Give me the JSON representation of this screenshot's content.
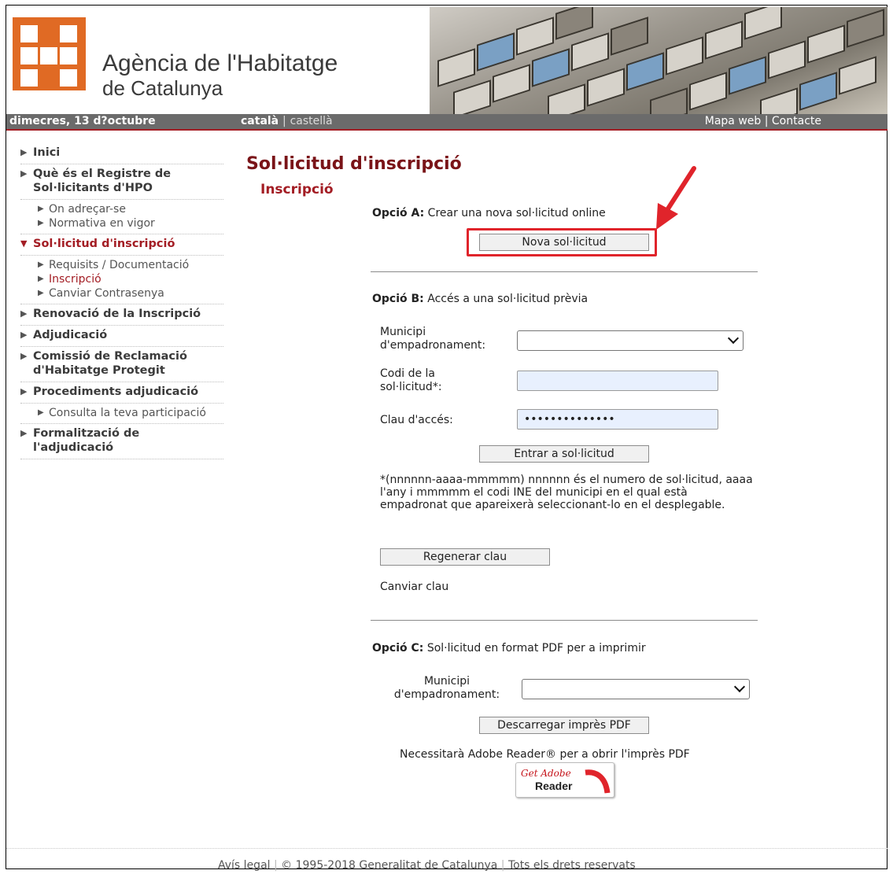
{
  "header": {
    "brand_line1": "Agència de l'Habitatge",
    "brand_line2": "de Catalunya"
  },
  "navbar": {
    "date": "dimecres, 13 d?octubre",
    "lang_current": "català",
    "lang_separator": "|",
    "lang_alt": "castellà",
    "links": "Mapa web | Contacte"
  },
  "sidebar": {
    "items": [
      {
        "label": "Inici"
      },
      {
        "label": "Què és el Registre de Sol·licitants d'HPO"
      },
      {
        "label": "On adreçar-se"
      },
      {
        "label": "Normativa en vigor"
      },
      {
        "label": "Sol·licitud d'inscripció"
      },
      {
        "label": "Requisits / Documentació"
      },
      {
        "label": "Inscripció"
      },
      {
        "label": "Canviar Contrasenya"
      },
      {
        "label": "Renovació de la Inscripció"
      },
      {
        "label": "Adjudicació"
      },
      {
        "label": "Comissió de Reclamació d'Habitatge Protegit"
      },
      {
        "label": "Procediments adjudicació"
      },
      {
        "label": "Consulta la teva participació"
      },
      {
        "label": "Formalització de l'adjudicació"
      }
    ]
  },
  "main": {
    "title": "Sol·licitud d'inscripció",
    "subtitle": "Inscripció",
    "optionA": {
      "heading": "Opció A:",
      "text": "Crear una nova sol·licitud online",
      "button": "Nova sol·licitud"
    },
    "optionB": {
      "heading": "Opció B:",
      "text": "Accés a una sol·licitud prèvia",
      "municipi_label_1": "Municipi",
      "municipi_label_2": "d'empadronament:",
      "municipi_value": "",
      "codi_label_1": "Codi de la",
      "codi_label_2": "sol·licitud*:",
      "codi_value": "",
      "clau_label": "Clau d'accés:",
      "clau_value": "••••••••••••••",
      "enter_button": "Entrar a sol·licitud",
      "note": "*(nnnnnn-aaaa-mmmmm) nnnnnn és el numero de sol·licitud, aaaa l'any i mmmmm el codi INE del municipi en el qual està empadronat que apareixerà seleccionant-lo en el desplegable.",
      "regen_button": "Regenerar clau",
      "change_key": "Canviar clau"
    },
    "optionC": {
      "heading": "Opció C:",
      "text": "Sol·licitud en format PDF per a imprimir",
      "municipi_label_1": "Municipi",
      "municipi_label_2": "d'empadronament:",
      "municipi_value": "",
      "download_button": "Descarregar imprès PDF",
      "reader_note": "Necessitarà Adobe Reader® per a obrir l'imprès PDF",
      "adobe_get": "Get Adobe",
      "adobe_reader": "Reader"
    }
  },
  "footer": {
    "legal": "Avís legal",
    "copyright": "© 1995-2018 Generalitat de Catalunya",
    "rights": "Tots els drets reservats"
  },
  "colors": {
    "accent": "#a31d24",
    "logo_orange": "#e06a24",
    "navbar_bg": "#6b6b6b",
    "highlight_red": "#e0242b"
  }
}
